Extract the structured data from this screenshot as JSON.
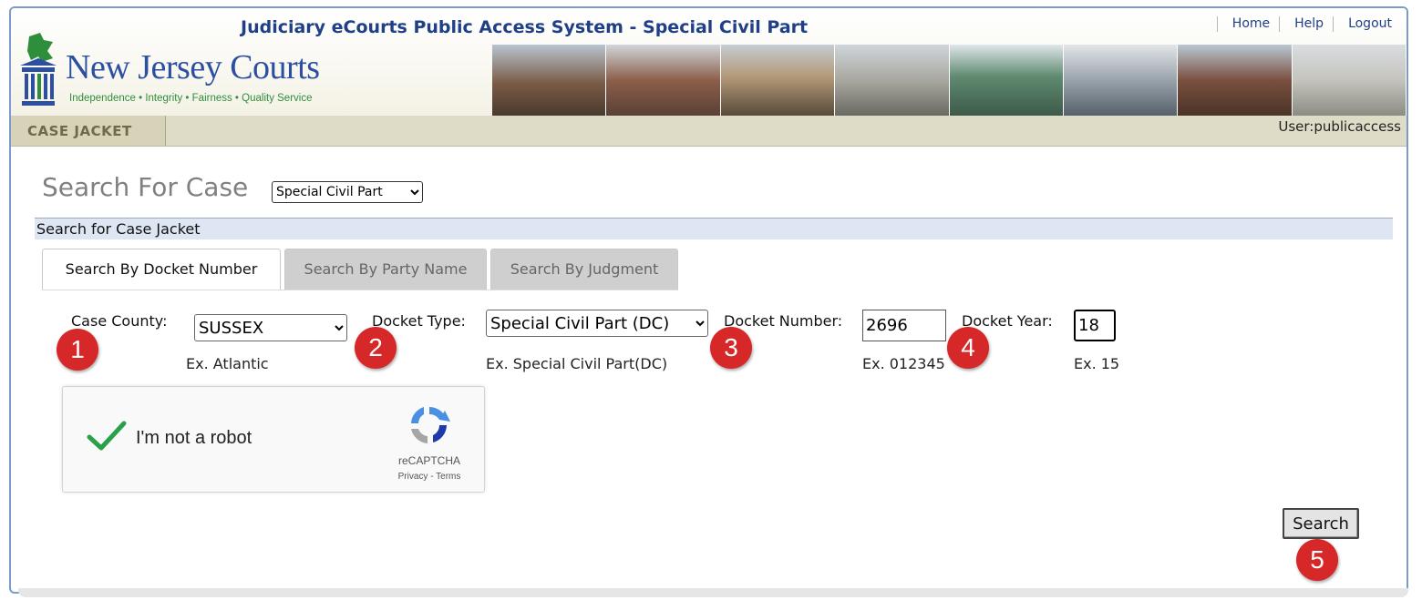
{
  "header": {
    "app_title": "Judiciary eCourts Public Access System - Special Civil Part",
    "links": [
      "Home",
      "Help",
      "Logout"
    ],
    "logo_text": "New Jersey Courts",
    "logo_tagline": "Independence • Integrity • Fairness • Quality Service"
  },
  "tabbar": {
    "case_jacket": "CASE JACKET",
    "user": "User:publicaccess"
  },
  "page": {
    "title": "Search For Case",
    "court_select": "Special Civil Part",
    "section_title": "Search for Case Jacket"
  },
  "tabs": [
    {
      "label": "Search By Docket Number",
      "active": true
    },
    {
      "label": "Search By Party Name",
      "active": false
    },
    {
      "label": "Search By Judgment",
      "active": false
    }
  ],
  "form": {
    "county": {
      "label": "Case County:",
      "value": "SUSSEX",
      "hint": "Ex. Atlantic"
    },
    "docket_type": {
      "label": "Docket Type:",
      "value": "Special Civil Part (DC)",
      "hint": "Ex. Special Civil Part(DC)"
    },
    "docket_number": {
      "label": "Docket Number:",
      "value": "2696",
      "hint": "Ex. 012345"
    },
    "docket_year": {
      "label": "Docket Year:",
      "value": "18",
      "hint": "Ex. 15"
    }
  },
  "captcha": {
    "label": "I'm not a robot",
    "brand": "reCAPTCHA",
    "legal": "Privacy - Terms"
  },
  "search_button": "Search",
  "markers": [
    "1",
    "2",
    "3",
    "4",
    "5"
  ],
  "colors": {
    "title_blue": "#1f3f86",
    "marker_red": "#d62828",
    "tabbar": "#dedcc7",
    "section_bar": "#dde6f2"
  },
  "icons": [
    "nj-courts-logo-icon",
    "checkmark-icon",
    "recaptcha-logo-icon",
    "dropdown-arrow-icon"
  ]
}
